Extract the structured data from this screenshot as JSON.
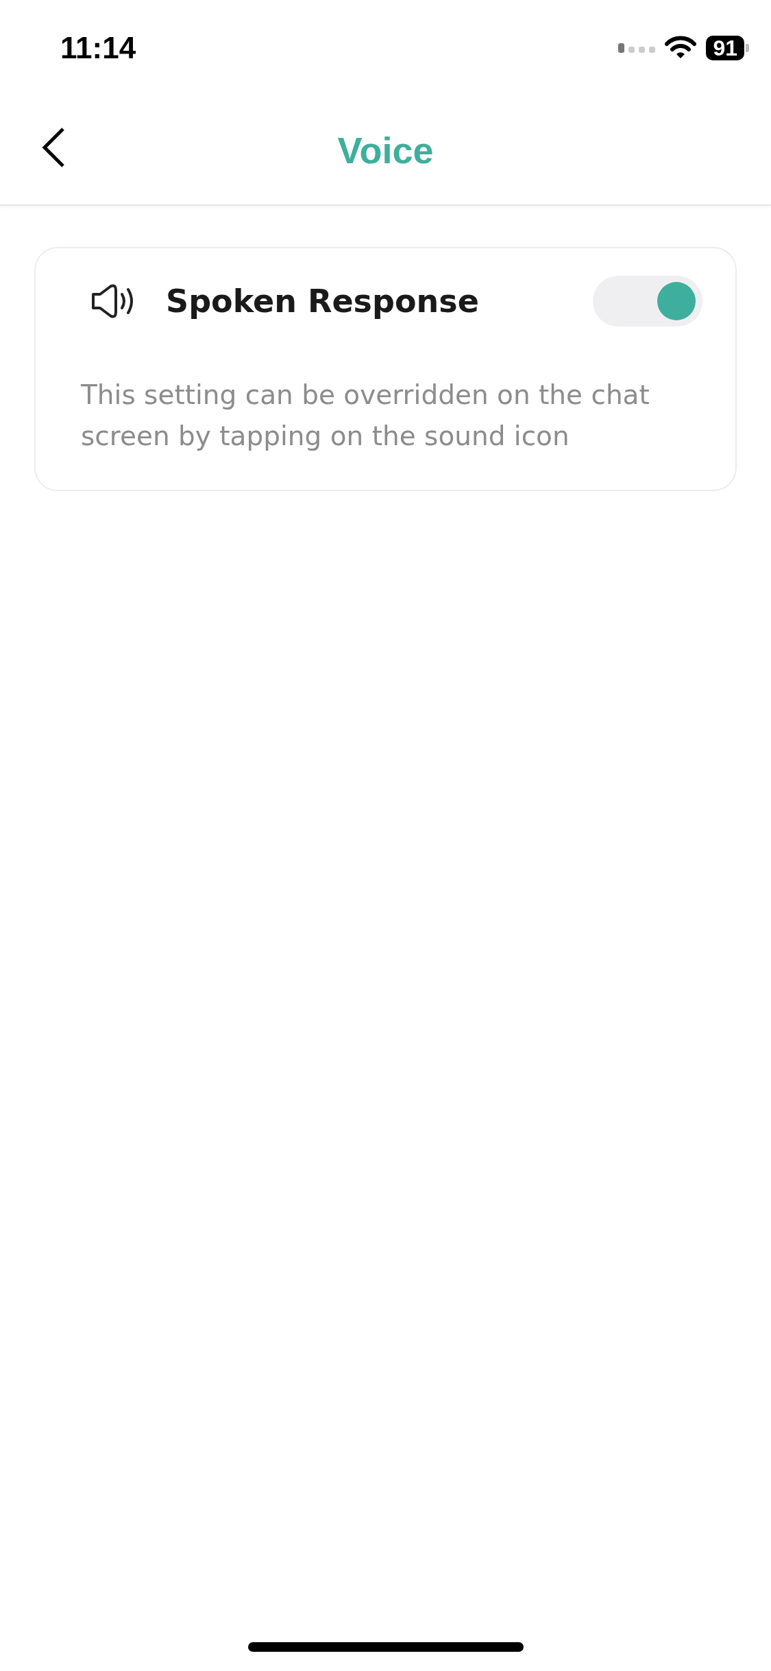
{
  "status_bar": {
    "time": "11:14",
    "battery": "91"
  },
  "header": {
    "title": "Voice"
  },
  "settings": [
    {
      "kind": "toggle",
      "label": "Spoken Response",
      "on": true,
      "description": "This setting can be overridden on the chat screen by tapping on the sound icon"
    }
  ]
}
